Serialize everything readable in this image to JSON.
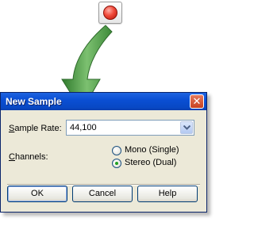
{
  "record_button": {
    "icon": "record-icon"
  },
  "arrow": {
    "icon": "curved-arrow-icon",
    "color": "#4f9a4a"
  },
  "dialog": {
    "title": "New Sample",
    "close_icon": "close-icon",
    "sample_rate": {
      "label_accel": "S",
      "label_rest": "ample Rate:",
      "value": "44,100"
    },
    "channels": {
      "label_accel": "C",
      "label_rest": "hannels:",
      "options": [
        {
          "label": "Mono (Single)",
          "selected": false
        },
        {
          "label": "Stereo (Dual)",
          "selected": true
        }
      ]
    },
    "buttons": {
      "ok": "OK",
      "cancel": "Cancel",
      "help": "Help"
    }
  }
}
